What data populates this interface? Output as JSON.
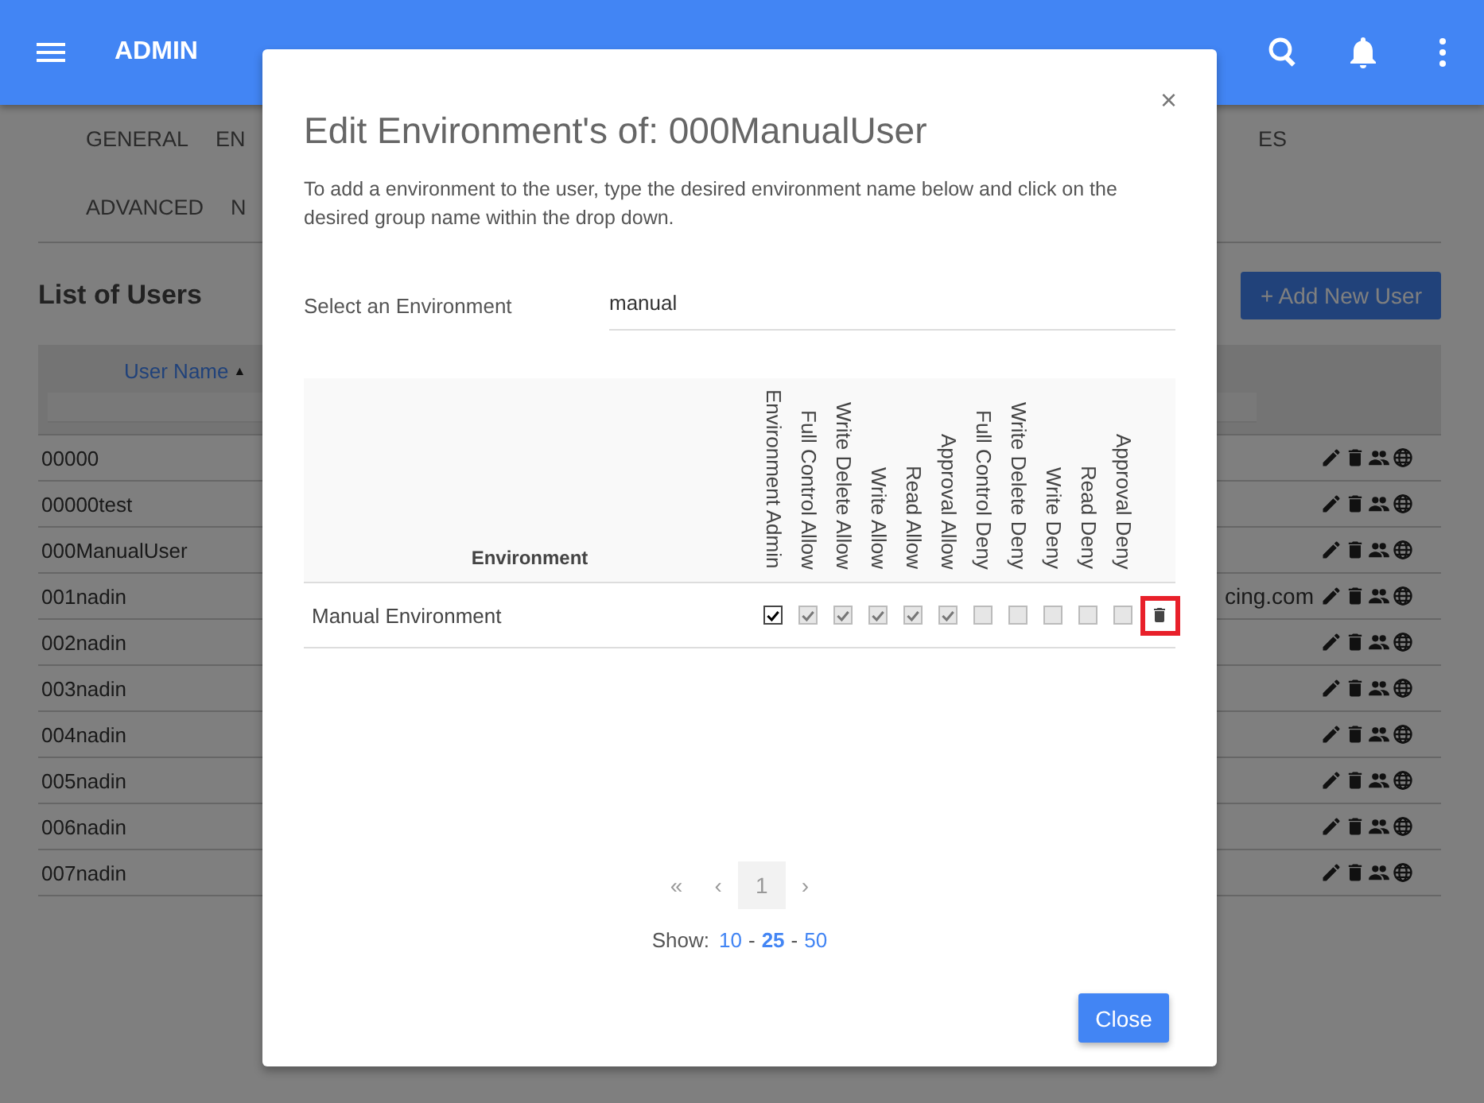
{
  "app_bar": {
    "title": "ADMIN"
  },
  "tab_rows": [
    {
      "tabs": [
        {
          "label": "GENERAL"
        },
        {
          "label": "EN"
        },
        {
          "label": "ES"
        }
      ]
    },
    {
      "tabs": [
        {
          "label": "ADVANCED"
        },
        {
          "label": "N"
        }
      ]
    }
  ],
  "users": {
    "title": "List of Users",
    "add_button": "+ Add New User",
    "columns": [
      {
        "label": "User Name",
        "sort_indicator": "▲"
      }
    ],
    "rows": [
      {
        "user_name": "00000"
      },
      {
        "user_name": "00000test"
      },
      {
        "user_name": "000ManualUser"
      },
      {
        "user_name": "001nadin",
        "column_2": "cing.com"
      },
      {
        "user_name": "002nadin"
      },
      {
        "user_name": "003nadin"
      },
      {
        "user_name": "004nadin"
      },
      {
        "user_name": "005nadin"
      },
      {
        "user_name": "006nadin"
      },
      {
        "user_name": "007nadin"
      }
    ]
  },
  "dialog": {
    "title": "Edit Environment's of: 000ManualUser",
    "close_icon": "×",
    "description": "To add a environment to the user, type the desired environment name below and click on the desired group name within the drop down.",
    "field": {
      "label": "Select an Environment",
      "value": "manual"
    },
    "table": {
      "columns": [
        {
          "label": "Environment"
        },
        {
          "label": "Environment Admin"
        },
        {
          "label": "Full Control Allow"
        },
        {
          "label": "Write Delete Allow"
        },
        {
          "label": "Write Allow"
        },
        {
          "label": "Read Allow"
        },
        {
          "label": "Approval Allow"
        },
        {
          "label": "Full Control Deny"
        },
        {
          "label": "Write Delete Deny"
        },
        {
          "label": "Write Deny"
        },
        {
          "label": "Read Deny"
        },
        {
          "label": "Approval Deny"
        }
      ],
      "rows": [
        {
          "name": "Manual Environment",
          "delete_highlighted": true,
          "permissions": [
            {
              "checked": true,
              "disabled": false
            },
            {
              "checked": true,
              "disabled": true
            },
            {
              "checked": true,
              "disabled": true
            },
            {
              "checked": true,
              "disabled": true
            },
            {
              "checked": true,
              "disabled": true
            },
            {
              "checked": true,
              "disabled": true
            },
            {
              "checked": false,
              "disabled": true
            },
            {
              "checked": false,
              "disabled": true
            },
            {
              "checked": false,
              "disabled": true
            },
            {
              "checked": false,
              "disabled": true
            },
            {
              "checked": false,
              "disabled": true
            }
          ]
        }
      ]
    },
    "pagination": {
      "first": "«",
      "prev": "‹",
      "next": "›",
      "pages": [
        {
          "label": "1",
          "selected": true
        }
      ]
    },
    "page_size": {
      "label": "Show:",
      "options": [
        {
          "label": "10",
          "selected": false
        },
        {
          "label": "25",
          "selected": true
        },
        {
          "label": "50",
          "selected": false
        }
      ],
      "separator": "-"
    },
    "close_button": "Close"
  }
}
